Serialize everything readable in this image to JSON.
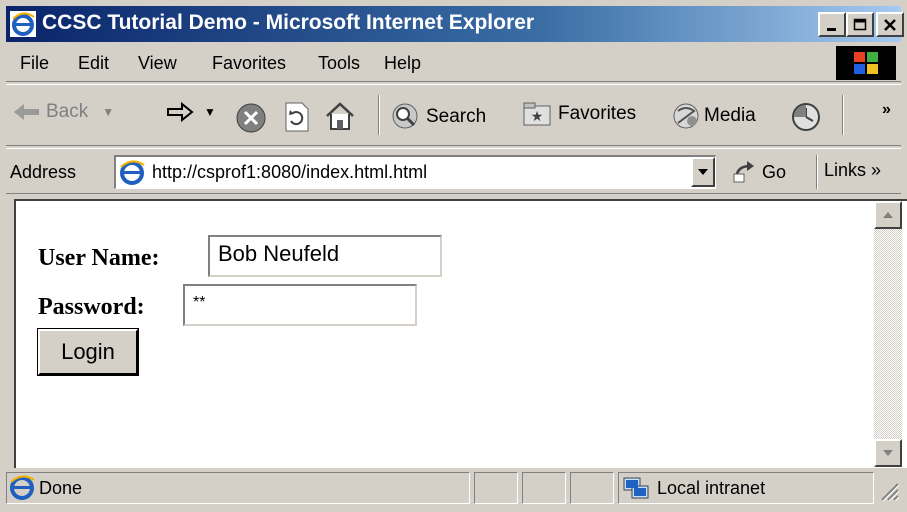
{
  "window": {
    "title": "CCSC Tutorial Demo - Microsoft Internet Explorer",
    "minimize_glyph": "_",
    "maximize_glyph": "□",
    "close_glyph": "×"
  },
  "menu": {
    "file": "File",
    "edit": "Edit",
    "view": "View",
    "favorites": "Favorites",
    "tools": "Tools",
    "help": "Help"
  },
  "toolbar": {
    "back": "Back",
    "search": "Search",
    "favorites": "Favorites",
    "media": "Media",
    "more": "»"
  },
  "address": {
    "label": "Address",
    "url": "http://csprof1:8080/index.html.html",
    "go": "Go",
    "links": "Links »"
  },
  "form": {
    "username_label": "User Name:",
    "username_value": "Bob Neufeld",
    "password_label": "Password:",
    "password_value": "**",
    "login_button": "Login"
  },
  "status": {
    "text": "Done",
    "zone": "Local intranet"
  },
  "colors": {
    "titlebar_start": "#0a246a",
    "titlebar_end": "#a6caf0",
    "chrome": "#d4d0c8",
    "content_bg": "#ffffff"
  },
  "icons": [
    "ie-logo-icon",
    "windows-logo-icon",
    "back-arrow-icon",
    "forward-arrow-icon",
    "stop-icon",
    "refresh-icon",
    "home-icon",
    "search-icon",
    "favorites-icon",
    "media-icon",
    "history-icon",
    "go-arrow-icon",
    "dropdown-arrow-icon",
    "scroll-up-icon",
    "scroll-down-icon",
    "page-done-icon",
    "local-intranet-icon",
    "resize-grip-icon"
  ]
}
